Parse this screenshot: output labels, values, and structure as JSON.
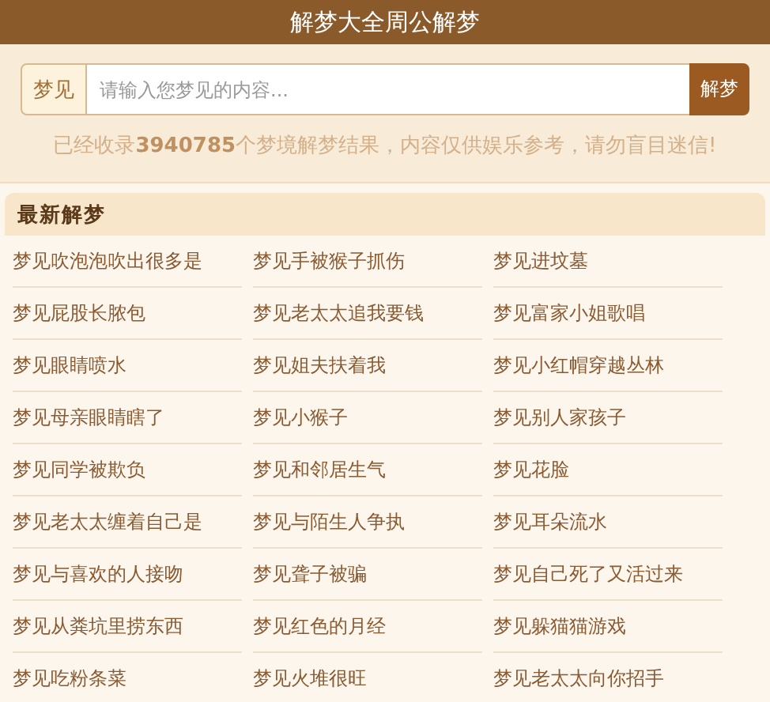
{
  "header": {
    "title": "解梦大全周公解梦"
  },
  "search": {
    "prefix": "梦见",
    "placeholder": "请输入您梦见的内容...",
    "button": "解梦"
  },
  "notice": "已经收录**3940785**个梦境解梦结果，内容仅供娱乐参考，请勿盲目迷信!",
  "latest": {
    "title": "最新解梦",
    "items": [
      "梦见吹泡泡吹出很多是",
      "梦见手被猴子抓伤",
      "梦见进坟墓",
      "梦见屁股长脓包",
      "梦见老太太追我要钱",
      "梦见富家小姐歌唱",
      "梦见眼睛喷水",
      "梦见姐夫扶着我",
      "梦见小红帽穿越丛林",
      "梦见母亲眼睛瞎了",
      "梦见小猴子",
      "梦见别人家孩子",
      "梦见同学被欺负",
      "梦见和邻居生气",
      "梦见花脸",
      "梦见老太太缠着自己是",
      "梦见与陌生人争执",
      "梦见耳朵流水",
      "梦见与喜欢的人接吻",
      "梦见聋子被骗",
      "梦见自己死了又活过来",
      "梦见从粪坑里捞东西",
      "梦见红色的月经",
      "梦见躲猫猫游戏",
      "梦见吃粉条菜",
      "梦见火堆很旺",
      "梦见老太太向你招手"
    ]
  }
}
